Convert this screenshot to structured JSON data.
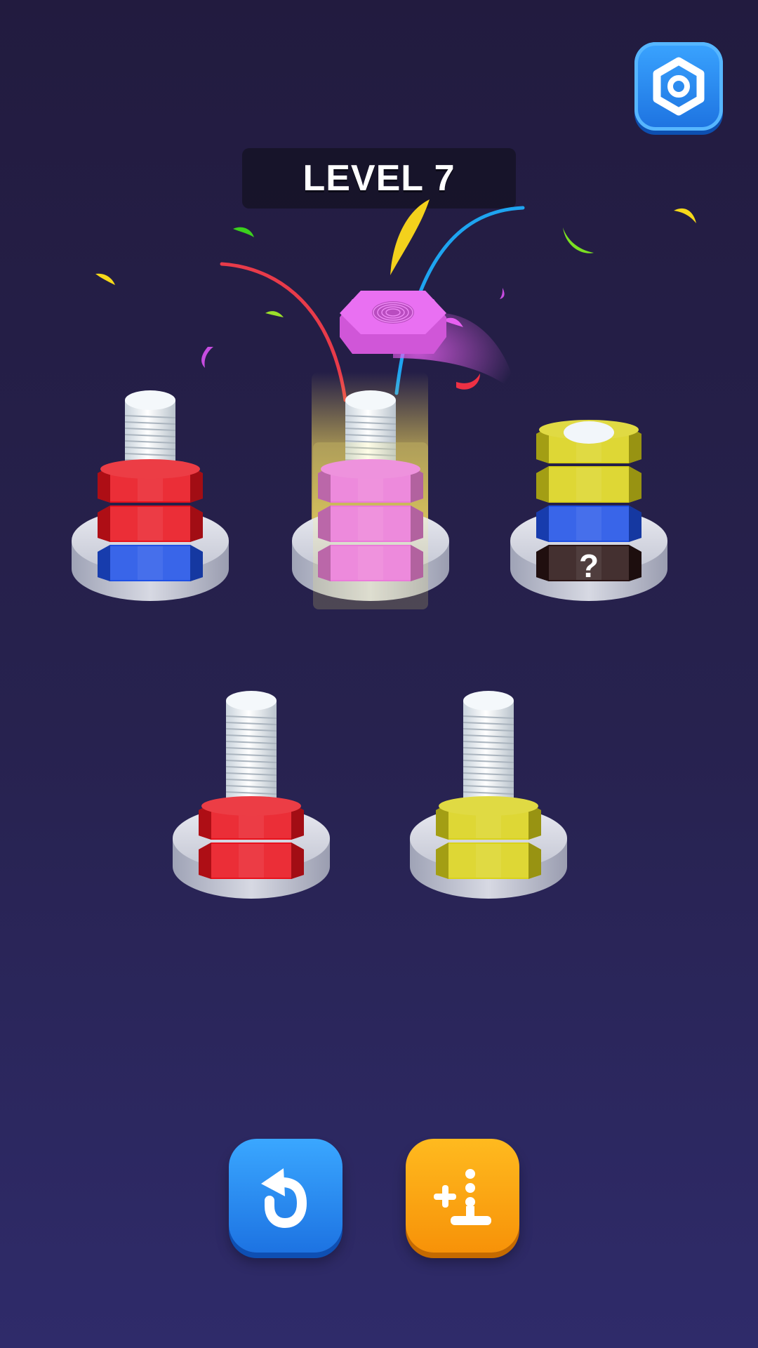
{
  "level": {
    "label": "LEVEL 7"
  },
  "icons": {
    "settings": "hex-nut-gear-icon",
    "undo": "undo-arrow-icon",
    "add_bolt": "add-bolt-icon",
    "hidden_nut": "question-mark-icon"
  },
  "colors": {
    "red": "#e8121c",
    "blue": "#1e50e6",
    "pink": "#e760f0",
    "yellow": "#d9d21a",
    "hidden": "#2a1414",
    "base": "#c9ccd8",
    "screw": "#e8eef4",
    "glow": "#ffe35a"
  },
  "bolts": [
    {
      "nuts": [
        "blue",
        "red",
        "red"
      ],
      "highlighted": false
    },
    {
      "nuts": [
        "pink",
        "pink",
        "pink"
      ],
      "highlighted": true
    },
    {
      "nuts": [
        "hidden",
        "blue",
        "yellow",
        "yellow"
      ],
      "highlighted": false
    },
    {
      "nuts": [
        "red",
        "red"
      ],
      "highlighted": false
    },
    {
      "nuts": [
        "yellow",
        "yellow"
      ],
      "highlighted": false
    }
  ],
  "lifted_nut": {
    "color": "pink"
  },
  "hidden_nut_mark": "?"
}
